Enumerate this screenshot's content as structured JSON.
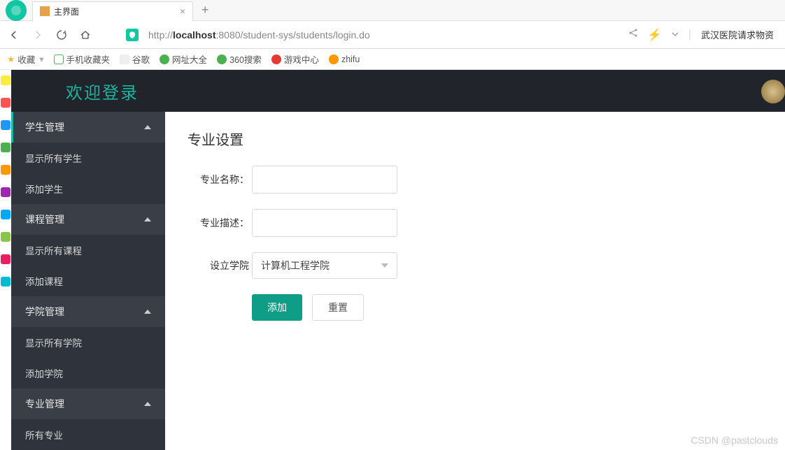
{
  "browser": {
    "tab_title": "主界面",
    "url_prefix": "http://",
    "url_host": "localhost",
    "url_path": ":8080/student-sys/students/login.do",
    "news_link": "武汉医院请求物资"
  },
  "bookmarks": {
    "fav": "收藏",
    "items": [
      "手机收藏夹",
      "谷歌",
      "网址大全",
      "360搜索",
      "游戏中心",
      "zhifu"
    ]
  },
  "app": {
    "header_title": "欢迎登录"
  },
  "sidebar": {
    "groups": [
      {
        "label": "学生管理",
        "items": [
          "显示所有学生",
          "添加学生"
        ]
      },
      {
        "label": "课程管理",
        "items": [
          "显示所有课程",
          "添加课程"
        ]
      },
      {
        "label": "学院管理",
        "items": [
          "显示所有学院",
          "添加学院"
        ]
      },
      {
        "label": "专业管理",
        "items": [
          "所有专业"
        ]
      }
    ]
  },
  "form": {
    "title": "专业设置",
    "name_label": "专业名称：",
    "desc_label": "专业描述：",
    "college_label": "设立学院",
    "college_value": "计算机工程学院",
    "submit": "添加",
    "reset": "重置"
  },
  "watermark": "CSDN @pastclouds"
}
